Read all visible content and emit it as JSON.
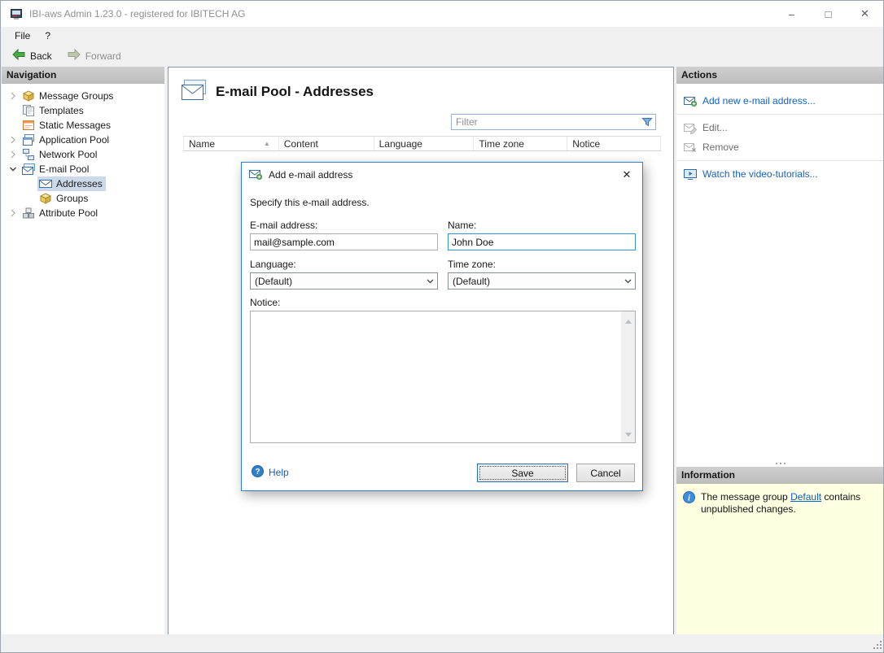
{
  "window": {
    "title": "IBI-aws Admin 1.23.0 - registered for IBITECH AG",
    "controls": {
      "minimize": "–",
      "maximize": "□",
      "close": "✕"
    }
  },
  "menu": {
    "items": [
      {
        "label": "File"
      },
      {
        "label": "?"
      }
    ]
  },
  "toolbar": {
    "back_label": "Back",
    "forward_label": "Forward"
  },
  "navigation": {
    "header": "Navigation",
    "items": [
      {
        "label": "Message Groups"
      },
      {
        "label": "Templates"
      },
      {
        "label": "Static Messages"
      },
      {
        "label": "Application Pool"
      },
      {
        "label": "Network Pool"
      },
      {
        "label": "E-mail Pool"
      },
      {
        "label": "Addresses"
      },
      {
        "label": "Groups"
      },
      {
        "label": "Attribute Pool"
      }
    ]
  },
  "main": {
    "title": "E-mail Pool - Addresses",
    "filter_placeholder": "Filter",
    "table": {
      "columns": [
        {
          "label": "Name",
          "sorted": "asc"
        },
        {
          "label": "Content"
        },
        {
          "label": "Language"
        },
        {
          "label": "Time zone"
        },
        {
          "label": "Notice"
        }
      ],
      "sort_indicator": "▲",
      "rows": []
    }
  },
  "actions": {
    "header": "Actions",
    "items": [
      {
        "label": "Add new e-mail address...",
        "enabled": true
      },
      {
        "label": "Edit...",
        "enabled": false
      },
      {
        "label": "Remove",
        "enabled": false
      },
      {
        "label": "Watch the video-tutorials...",
        "enabled": true
      }
    ]
  },
  "information": {
    "header": "Information",
    "message_prefix": "The message group ",
    "message_link": "Default",
    "message_suffix": " contains unpublished changes."
  },
  "dialog": {
    "title": "Add e-mail address",
    "close": "✕",
    "description": "Specify this e-mail address.",
    "fields": {
      "email_label": "E-mail address:",
      "email_value": "mail@sample.com",
      "name_label": "Name:",
      "name_value": "John Doe",
      "language_label": "Language:",
      "language_value": "(Default)",
      "timezone_label": "Time zone:",
      "timezone_value": "(Default)",
      "notice_label": "Notice:",
      "notice_value": ""
    },
    "help_label": "Help",
    "save_label": "Save",
    "cancel_label": "Cancel"
  }
}
